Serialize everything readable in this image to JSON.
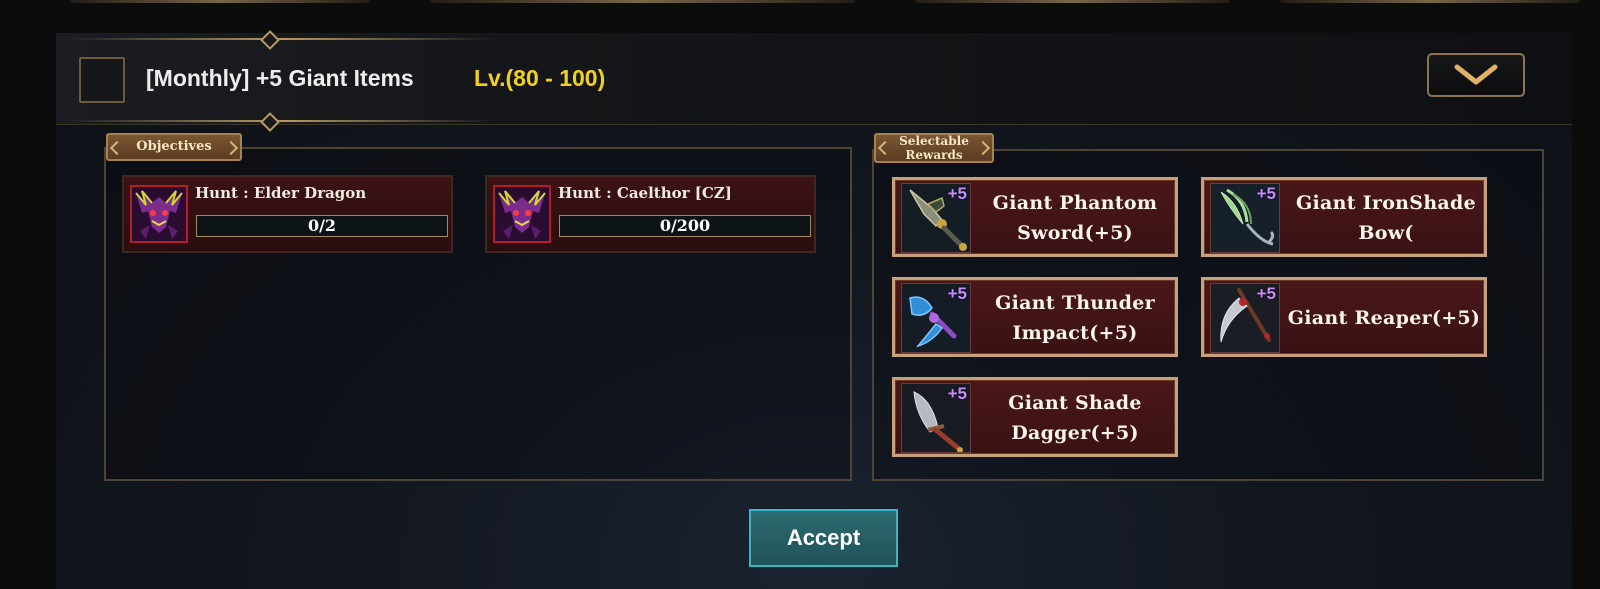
{
  "quest": {
    "title": "[Monthly] +5 Giant Items",
    "level": "Lv.(80 - 100)"
  },
  "objectives": {
    "label": "Objectives",
    "items": [
      {
        "name": "Hunt : Elder Dragon",
        "progress": "0/2",
        "current": 0,
        "total": 2,
        "icon": "demon-icon"
      },
      {
        "name": "Hunt : Caelthor [CZ]",
        "progress": "0/200",
        "current": 0,
        "total": 200,
        "icon": "demon-icon"
      }
    ]
  },
  "rewards": {
    "label": "Selectable Rewards",
    "items": [
      {
        "name": "Giant Phantom Sword(+5)",
        "badge": "+5",
        "icon": "sword-icon"
      },
      {
        "name": "Giant IronShade Bow(",
        "badge": "+5",
        "icon": "bow-icon"
      },
      {
        "name": "Giant Thunder Impact(+5)",
        "badge": "+5",
        "icon": "axe-icon"
      },
      {
        "name": "Giant Reaper(+5)",
        "badge": "+5",
        "icon": "scythe-icon"
      },
      {
        "name": "Giant Shade Dagger(+5)",
        "badge": "+5",
        "icon": "dagger-icon"
      }
    ]
  },
  "actions": {
    "accept": "Accept"
  },
  "colors": {
    "level": "#f0d020",
    "badge": "#c78cff",
    "accept": "#2e6b72"
  }
}
